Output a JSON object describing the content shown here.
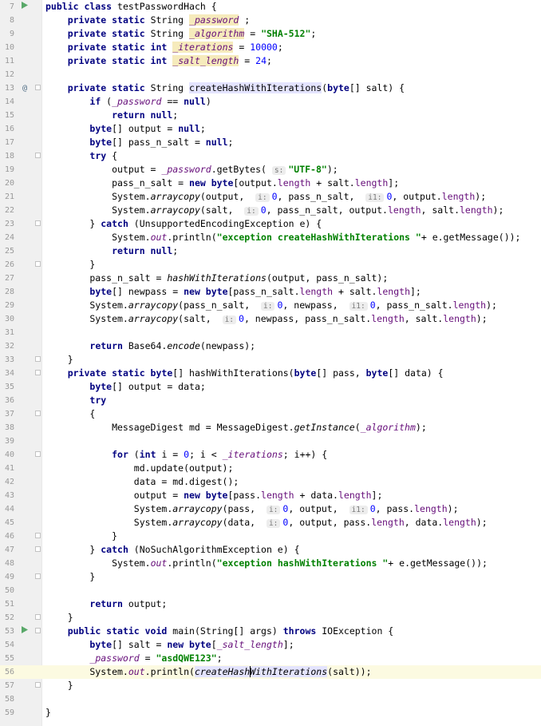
{
  "editor": {
    "class_name": "testPasswordHach",
    "fields": {
      "password": "_password",
      "algorithm": "_algorithm",
      "algorithm_value": "\"SHA-512\"",
      "iterations": "_iterations",
      "iterations_value": "10000",
      "salt_length": "_salt_length",
      "salt_length_value": "24"
    },
    "methods": {
      "create": "createHashWithIterations",
      "hash": "hashWithIterations",
      "main": "main"
    },
    "strings": {
      "utf8": "\"UTF-8\"",
      "exc_create": "\"exception createHashWithIterations \"",
      "exc_hash": "\"exception hashWithIterations \"",
      "password_literal": "\"asdQWE123\""
    },
    "hints": {
      "s": "s:",
      "i": "i:",
      "i1": "i1:"
    },
    "gutter": {
      "run_icon": "run-icon",
      "override_icon": "override-icon"
    },
    "current_line": 56
  }
}
